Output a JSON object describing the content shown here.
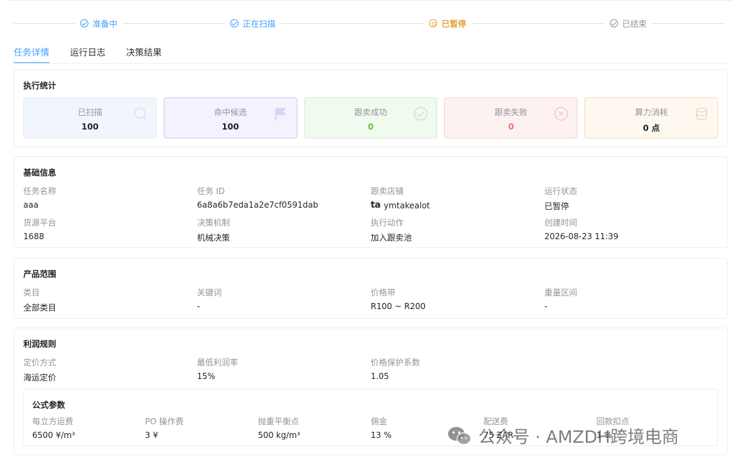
{
  "steps": [
    {
      "label": "准备中",
      "state": "done"
    },
    {
      "label": "正在扫描",
      "state": "done"
    },
    {
      "label": "已暂停",
      "state": "current"
    },
    {
      "label": "已结束",
      "state": "pending"
    }
  ],
  "tabs": [
    "任务详情",
    "运行日志",
    "决策结果"
  ],
  "stats": {
    "title": "执行统计",
    "items": [
      {
        "label": "已扫描",
        "value": "100",
        "icon": "search-icon"
      },
      {
        "label": "命中候选",
        "value": "100",
        "icon": "flag-icon"
      },
      {
        "label": "跟卖成功",
        "value": "0",
        "icon": "check-circle-icon"
      },
      {
        "label": "跟卖失败",
        "value": "0",
        "icon": "close-circle-icon"
      },
      {
        "label": "算力消耗",
        "value": "0 点",
        "icon": "coins-icon"
      }
    ]
  },
  "basic": {
    "title": "基础信息",
    "fields": [
      {
        "key": "任务名称",
        "value": "aaa"
      },
      {
        "key": "任务 ID",
        "value": "6a8a6b7eda1a2e7cf0591dab"
      },
      {
        "key": "跟卖店铺",
        "value": "ymtakealot",
        "logo": "ta"
      },
      {
        "key": "运行状态",
        "value": "已暂停"
      },
      {
        "key": "货源平台",
        "value": "1688"
      },
      {
        "key": "决策机制",
        "value": "机械决策"
      },
      {
        "key": "执行动作",
        "value": "加入跟卖池"
      },
      {
        "key": "创建时间",
        "value": "2026-08-23 11:39"
      }
    ]
  },
  "product": {
    "title": "产品范围",
    "fields": [
      {
        "key": "类目",
        "value": "全部类目"
      },
      {
        "key": "关键词",
        "value": "-"
      },
      {
        "key": "价格带",
        "value": "R100 ~ R200"
      },
      {
        "key": "重量区间",
        "value": "-"
      }
    ]
  },
  "profit": {
    "title": "利润规则",
    "fields": [
      {
        "key": "定价方式",
        "value": "海运定价"
      },
      {
        "key": "最低利润率",
        "value": "15%"
      },
      {
        "key": "价格保护系数",
        "value": "1.05"
      }
    ],
    "formula": {
      "title": "公式参数",
      "fields": [
        {
          "key": "每立方运费",
          "value": "6500 ¥/m³"
        },
        {
          "key": "PO 操作费",
          "value": "3 ¥"
        },
        {
          "key": "抛重平衡点",
          "value": "500 kg/m³"
        },
        {
          "key": "佣金",
          "value": "13 %"
        },
        {
          "key": "配送费",
          "value": "75 ZAR"
        },
        {
          "key": "回款扣点",
          "value": "1 %"
        }
      ]
    }
  },
  "watermark": "公众号 · AMZDH跨境电商",
  "colors": {
    "primary": "#409eff",
    "paused": "#e6a23c",
    "success": "#67c23a",
    "danger": "#f56c6c"
  }
}
